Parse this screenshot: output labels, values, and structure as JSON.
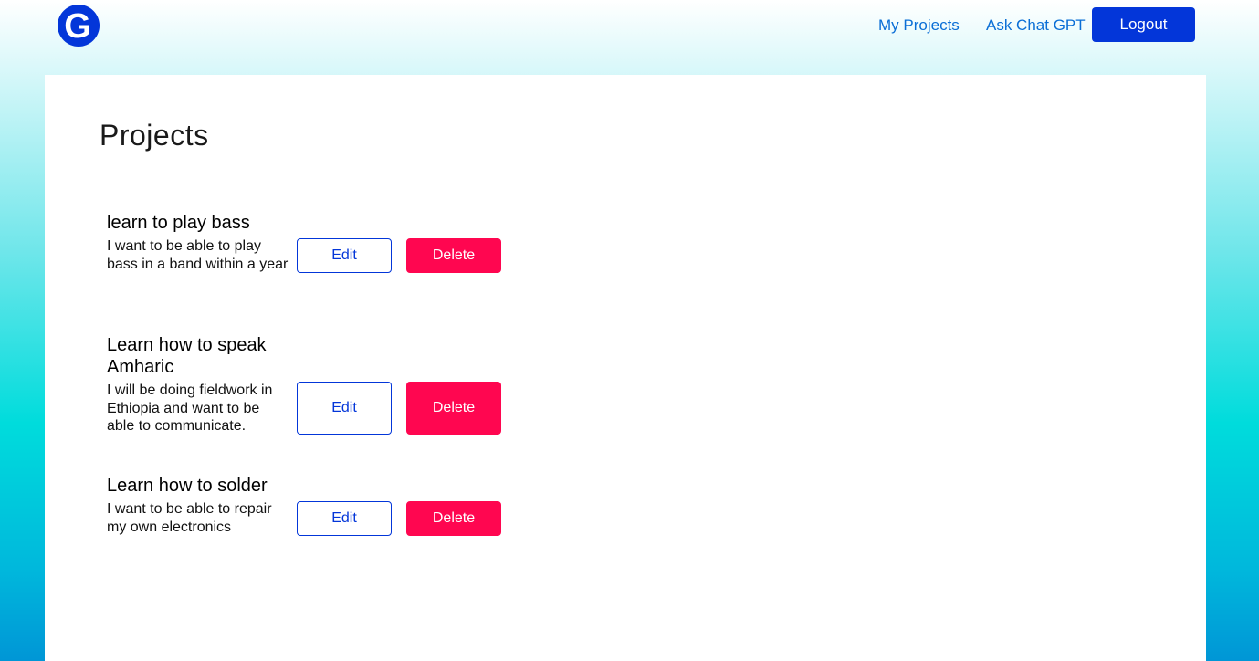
{
  "nav": {
    "logo_icon": "g-logo-icon",
    "logo_letter": "G",
    "my_projects": "My Projects",
    "ask_chat_gpt": "Ask Chat GPT",
    "logout": "Logout"
  },
  "page": {
    "title": "Projects"
  },
  "projects": [
    {
      "title": "learn to play bass",
      "description": "I want to be able to play bass in a band within a year",
      "edit_label": "Edit",
      "delete_label": "Delete"
    },
    {
      "title": "Learn how to speak Amharic",
      "description": "I will be doing fieldwork in Ethiopia and want to be able to communicate.",
      "edit_label": "Edit",
      "delete_label": "Delete"
    },
    {
      "title": "Learn how to solder",
      "description": "I want to be able to repair my own electronics",
      "edit_label": "Edit",
      "delete_label": "Delete"
    }
  ],
  "colors": {
    "primary": "#0336d9",
    "danger": "#ff0650",
    "link": "#0a6ed6"
  }
}
